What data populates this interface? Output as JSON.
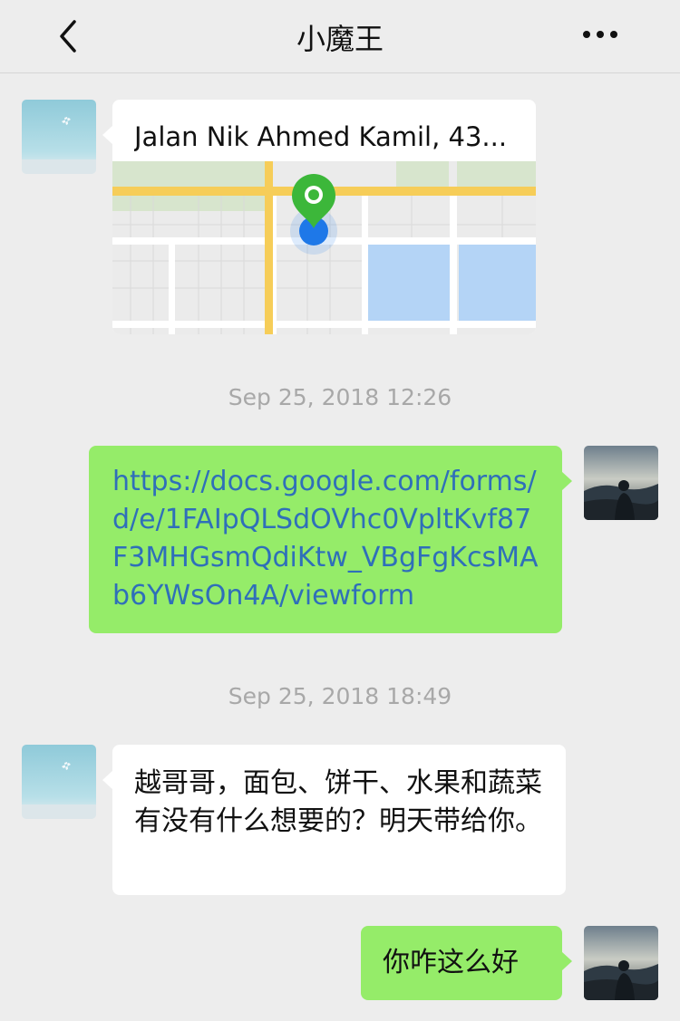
{
  "header": {
    "title": "小魔王",
    "back_icon": "chevron-left-icon",
    "more_icon": "more-dots-icon"
  },
  "messages": [
    {
      "side": "left",
      "type": "location",
      "location_title": "Jalan Nik Ahmed Kamil, 43..."
    },
    {
      "type": "timestamp",
      "text": "Sep 25, 2018 12:26"
    },
    {
      "side": "right",
      "type": "link",
      "text": "https://docs.google.com/forms/d/e/1FAIpQLSdOVhc0VpltKvf87F3MHGsmQdiKtw_VBgFgKcsMAb6YWsOn4A/viewform"
    },
    {
      "type": "timestamp",
      "text": "Sep 25, 2018 18:49"
    },
    {
      "side": "left",
      "type": "text",
      "text": "越哥哥，面包、饼干、水果和蔬菜有没有什么想要的？明天带给你。"
    },
    {
      "side": "right",
      "type": "text",
      "text": "你咋这么好"
    }
  ],
  "colors": {
    "background": "#ededed",
    "bubble_sent": "#95ec69",
    "bubble_received": "#ffffff",
    "link": "#2f6fb9",
    "timestamp": "#a8a8a8",
    "map_pin": "#3cb73a",
    "map_dot": "#1e78e8"
  }
}
